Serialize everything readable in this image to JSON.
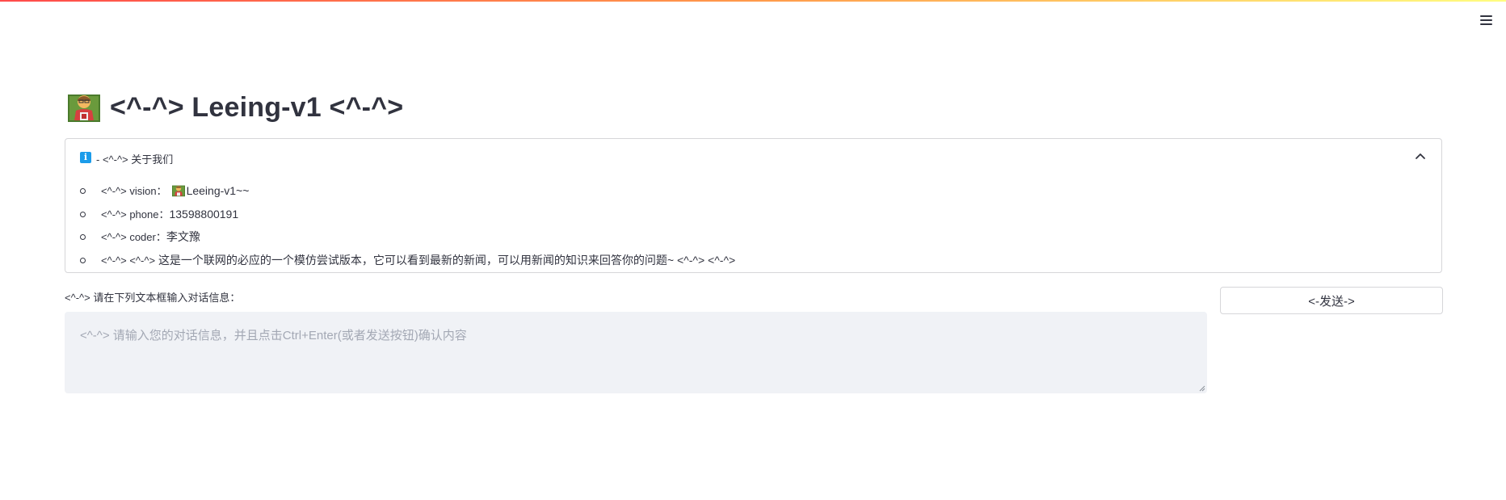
{
  "header": {
    "menu_icon": "hamburger-menu-icon"
  },
  "page": {
    "title_emoji": "teacher-emoji",
    "title": "<^-^> Leeing-v1 <^-^>"
  },
  "expander": {
    "icon": "info-icon",
    "icon_glyph": "i",
    "title": "- <^-^> 关于我们",
    "chevron": "chevron-up-icon",
    "items": [
      {
        "prefix": "<^-^> vision：",
        "emoji": "teacher-emoji",
        "value": "Leeing-v1~~"
      },
      {
        "prefix": "<^-^> phone：",
        "value": "13598800191"
      },
      {
        "prefix": "<^-^> coder：",
        "value": "李文豫"
      },
      {
        "prefix": "<^-^> <^-^>",
        "value": "这是一个联网的必应的一个模仿尝试版本，它可以看到最新的新闻，可以用新闻的知识来回答你的问题~ <^-^> <^-^>"
      }
    ]
  },
  "chat": {
    "label": "<^-^> 请在下列文本框输入对话信息：",
    "placeholder": "<^-^> 请输入您的对话信息，并且点击Ctrl+Enter(或者发送按钮)确认内容",
    "value": "",
    "send_label": "<-发送->"
  },
  "colors": {
    "accent_gradient_start": "#ff4b4b",
    "accent_gradient_end": "#fffd80",
    "text": "#31333f",
    "input_bg": "#f0f2f6",
    "info_blue": "#1c9cea",
    "border": "#d6d6d9"
  }
}
